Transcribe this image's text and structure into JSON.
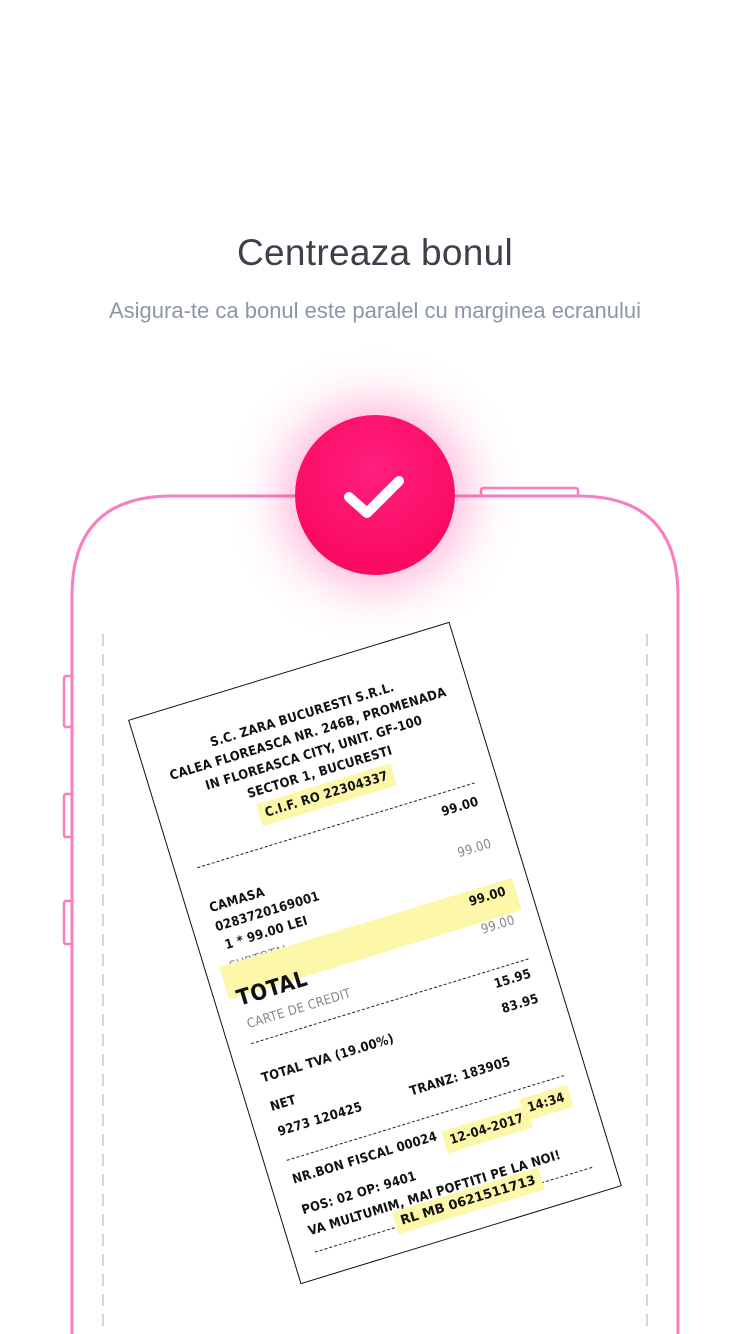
{
  "header": {
    "title": "Centreaza bonul",
    "subtitle": "Asigura-te ca bonul este paralel cu marginea ecranului"
  },
  "badge": {
    "icon": "checkmark-icon",
    "color": "#fa0b63"
  },
  "phone": {
    "outline_color": "#f77fbf"
  },
  "receipt": {
    "company": "S.C. ZARA BUCURESTI S.R.L.",
    "address_1": "CALEA FLOREASCA NR. 246B, PROMENADA",
    "address_2": "IN FLOREASCA CITY, UNIT. GF-100",
    "address_3": "SECTOR 1, BUCURESTI",
    "cif": "C.I.F. RO 22304337",
    "item_price": "99.00",
    "item_name": "CAMASA",
    "item_code": "0283720169001",
    "item_qty": "1 * 99.00 LEI",
    "item_price_gray": "99.00",
    "subtotal_label": "SUBTOTAL",
    "total_value": "99.00",
    "total_label": "TOTAL",
    "card_value": "99.00",
    "card_label": "CARTE DE CREDIT",
    "tva_value": "15.95",
    "tva_label": "TOTAL TVA (19.00%)",
    "net_value": "83.95",
    "net_label": "NET",
    "id_number": "9273 120425",
    "tranz": "TRANZ: 183905",
    "bon_label": "NR.BON FISCAL 00024",
    "date": "12-04-2017",
    "time": "14:34",
    "pos": "POS: 02 OP: 9401",
    "thanks": "VA MULTUMIM, MAI POFTITI PE LA NOI!",
    "rl": "RL MB 0621511713",
    "highlight_color": "#fdf7a9"
  }
}
